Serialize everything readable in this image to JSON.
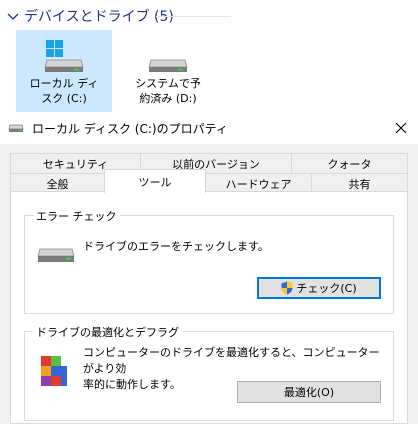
{
  "explorer": {
    "group_title": "デバイスとドライブ (5)",
    "drives": [
      {
        "label_line1": "ローカル ディ",
        "label_line2": "スク (C:)",
        "icon": "windows-drive-icon",
        "selected": true
      },
      {
        "label_line1": "システムで予",
        "label_line2": "約済み (D:)",
        "icon": "hard-drive-icon",
        "selected": false
      }
    ]
  },
  "dialog": {
    "title": "ローカル ディスク (C:)のプロパティ",
    "close_icon": "close-icon",
    "tabs_row1": [
      "セキュリティ",
      "以前のバージョン",
      "クォータ"
    ],
    "tabs_row2": [
      "全般",
      "ツール",
      "ハードウェア",
      "共有"
    ],
    "active_tab": "ツール",
    "error_check": {
      "title": "エラー チェック",
      "description": "ドライブのエラーをチェックします。",
      "button_label": "チェック(C)"
    },
    "optimize": {
      "title": "ドライブの最適化とデフラグ",
      "description_line1": "コンピューターのドライブを最適化すると、コンピューターがより効",
      "description_line2": "率的に動作します。",
      "button_label": "最適化(O)"
    }
  },
  "colors": {
    "selection": "#cce8ff",
    "accent": "#0078d7",
    "header_text": "#1e3287"
  }
}
